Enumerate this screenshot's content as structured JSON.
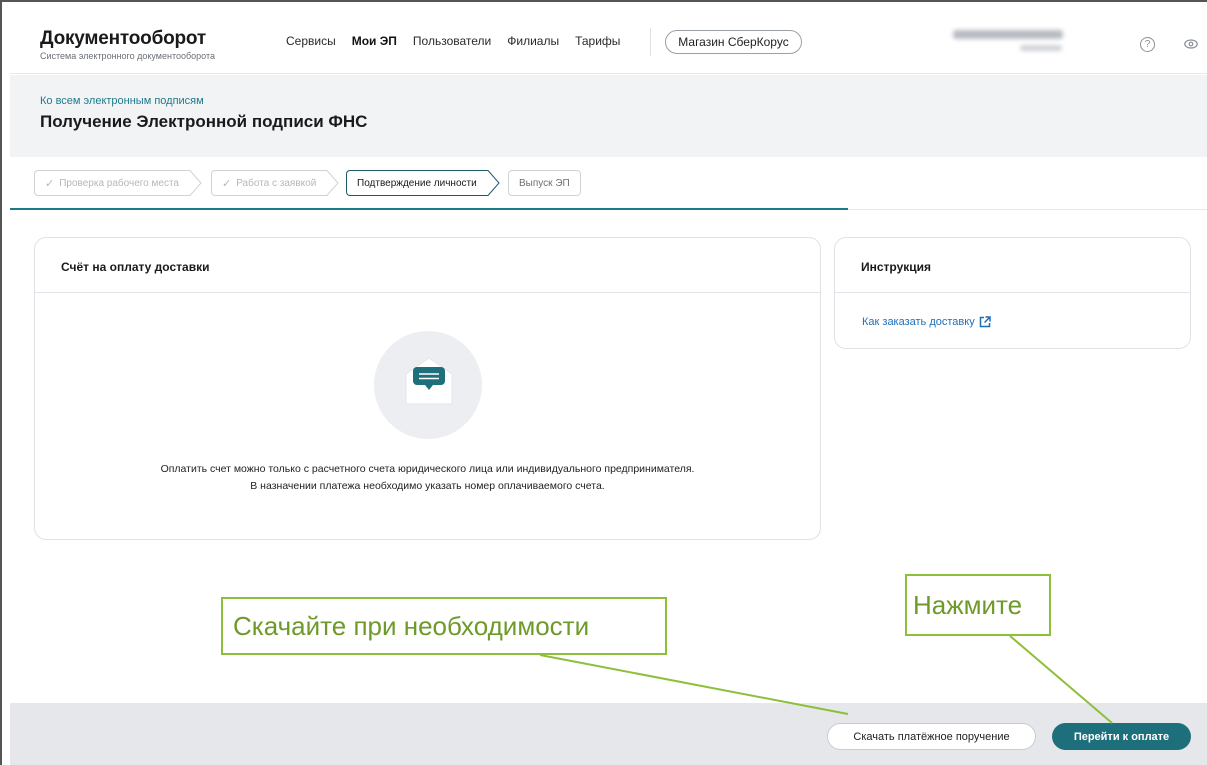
{
  "app": {
    "title": "Документооборот",
    "subtitle": "Система электронного документооборота"
  },
  "nav": {
    "items": [
      "Сервисы",
      "Мои ЭП",
      "Пользователи",
      "Филиалы",
      "Тарифы"
    ],
    "active_index": 1,
    "shop_button": "Магазин СберКорус"
  },
  "page": {
    "back_link": "Ко всем электронным подписям",
    "title": "Получение Электронной подписи ФНС"
  },
  "stepper": {
    "steps": [
      {
        "label": "Проверка рабочего места",
        "state": "done"
      },
      {
        "label": "Работа с заявкой",
        "state": "done"
      },
      {
        "label": "Подтверждение личности",
        "state": "current"
      },
      {
        "label": "Выпуск ЭП",
        "state": "future"
      }
    ]
  },
  "invoice_card": {
    "title": "Счёт на оплату доставки",
    "line1": "Оплатить счет можно только с расчетного счета юридического лица или индивидуального предпринимателя.",
    "line2": "В назначении платежа необходимо указать номер оплачиваемого счета."
  },
  "instruction_card": {
    "title": "Инструкция",
    "link": "Как заказать доставку"
  },
  "footer": {
    "download_button": "Скачать платёжное поручение",
    "pay_button": "Перейти к оплате"
  },
  "annotations": {
    "download_hint": "Скачайте при необходимости",
    "pay_hint": "Нажмите"
  },
  "colors": {
    "accent": "#1d6f7c",
    "link": "#1f6fb8",
    "annotation": "#8dbf3a"
  }
}
